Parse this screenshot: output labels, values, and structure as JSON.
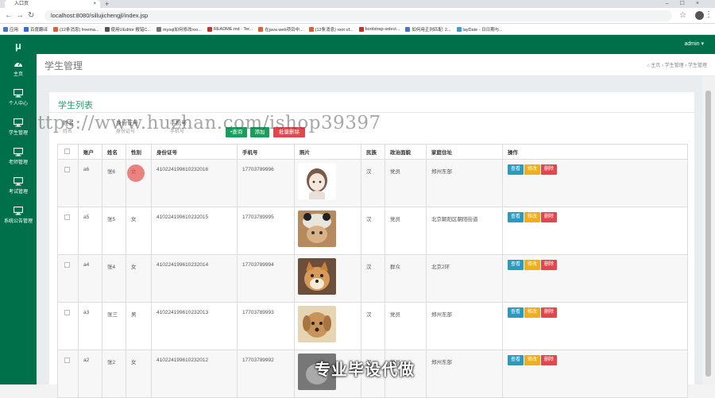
{
  "browser": {
    "tab_title": "入口页",
    "tab_close": "×",
    "new_tab": "+",
    "window_controls": "–☐×",
    "url": "localhost:8080/sillujichengjl/index.jsp",
    "bookmarks": [
      {
        "label": "应用",
        "color": "#4a73c9"
      },
      {
        "label": "百度翻译",
        "color": "#2b6be6"
      },
      {
        "label": "(12条消息) freema...",
        "color": "#e35d3a"
      },
      {
        "label": "使用UEditor 报错C...",
        "color": "#555555"
      },
      {
        "label": "mysql如何修改roo...",
        "color": "#777777"
      },
      {
        "label": "README.md · Ter...",
        "color": "#c9302c"
      },
      {
        "label": "在java web项目中...",
        "color": "#e35d3a"
      },
      {
        "label": "(12条消息) root of...",
        "color": "#e35d3a"
      },
      {
        "label": "bootstrap-select...",
        "color": "#c9302c"
      },
      {
        "label": "如何用正则匹配: 2...",
        "color": "#4a73c9"
      },
      {
        "label": "layDate - 日日期与...",
        "color": "#3aa0d8"
      }
    ]
  },
  "app": {
    "logo": "μ",
    "admin": "admin ▾",
    "page_title": "学生管理",
    "breadcrumb": [
      "主页",
      "学生管理",
      "学生管理"
    ],
    "sidebar": [
      {
        "label": "主页",
        "icon": "dashboard-icon"
      },
      {
        "label": "个人中心",
        "icon": "monitor-icon"
      },
      {
        "label": "学生管理",
        "icon": "monitor-icon"
      },
      {
        "label": "老师管理",
        "icon": "monitor-icon"
      },
      {
        "label": "考试管理",
        "icon": "monitor-icon"
      },
      {
        "label": "系统公告管理",
        "icon": "monitor-icon"
      }
    ]
  },
  "panel": {
    "title": "学生列表",
    "search": [
      {
        "label": "姓名",
        "placeholder": "姓名"
      },
      {
        "label": "身份证号",
        "placeholder": "身份证号"
      },
      {
        "label": "手机号",
        "placeholder": "手机号"
      }
    ],
    "buttons": {
      "query": "查询",
      "add": "添加",
      "batch_delete": "批量删除"
    },
    "columns": [
      "账户",
      "姓名",
      "性别",
      "身份证号",
      "手机号",
      "照片",
      "民族",
      "政治面貌",
      "家庭住址",
      "操作"
    ],
    "rows": [
      {
        "account": "a6",
        "name": "张6",
        "gender": "女",
        "id": "410224199610232016",
        "phone": "17703789996",
        "photo": "anime-girl",
        "nation": "汉",
        "politics": "党员",
        "address": "郑州东部"
      },
      {
        "account": "a5",
        "name": "张5",
        "gender": "女",
        "id": "410224199610232015",
        "phone": "17703789995",
        "photo": "cat-in-hat",
        "nation": "汉",
        "politics": "党员",
        "address": "北京朝阳区朝阳街道"
      },
      {
        "account": "a4",
        "name": "张4",
        "gender": "女",
        "id": "410224199610232014",
        "phone": "17703789994",
        "photo": "shiba-dog",
        "nation": "汉",
        "politics": "群众",
        "address": "北京2环"
      },
      {
        "account": "a3",
        "name": "张三",
        "gender": "男",
        "id": "410224199610232013",
        "phone": "17703789993",
        "photo": "puppy",
        "nation": "汉",
        "politics": "党员",
        "address": "郑州东部"
      },
      {
        "account": "a2",
        "name": "张2",
        "gender": "女",
        "id": "410224199610232012",
        "phone": "17703789992",
        "photo": "cat",
        "nation": "汉",
        "politics": "党员",
        "address": "郑州东部"
      }
    ],
    "row_actions": {
      "view": "查看",
      "edit": "修改",
      "delete": "删除"
    }
  },
  "overlay": {
    "watermark": "https://www.huzhan.com/ishop39397",
    "ad_text": "专业毕设代做"
  },
  "colors": {
    "primary_green": "#00704a",
    "title_green": "#1ea36a",
    "view_button": "#2a9bc0",
    "edit_button": "#f0ad1e",
    "delete_button": "#e2474e",
    "query_button": "#1a9e5b"
  }
}
